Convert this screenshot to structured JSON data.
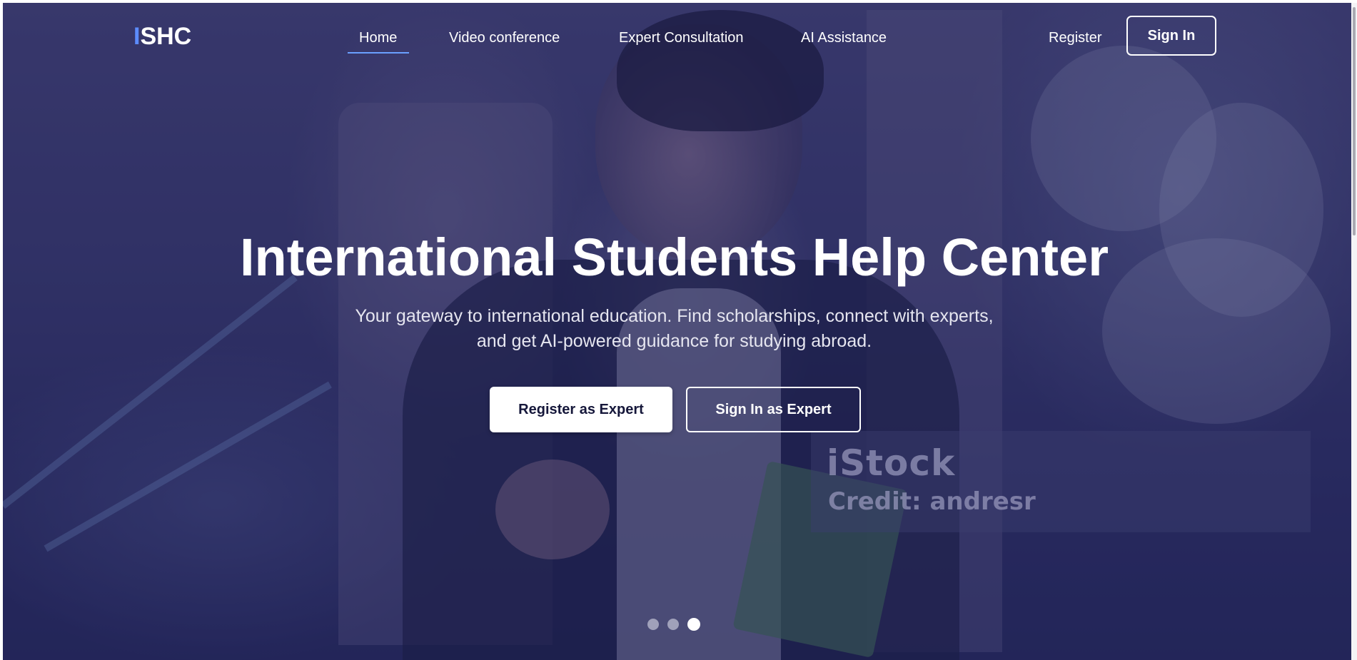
{
  "brand": {
    "logo_accent": "I",
    "logo_rest": "SHC",
    "accent_color": "#5c8cff"
  },
  "nav": {
    "items": [
      {
        "label": "Home",
        "active": true
      },
      {
        "label": "Video conference",
        "active": false
      },
      {
        "label": "Expert Consultation",
        "active": false
      },
      {
        "label": "AI Assistance",
        "active": false
      }
    ],
    "register_label": "Register",
    "signin_label": "Sign In"
  },
  "hero": {
    "title": "International Students Help Center",
    "subtitle_line1": "Your gateway to international education. Find scholarships, connect with experts,",
    "subtitle_line2": "and get AI-powered guidance for studying abroad.",
    "primary_button": "Register as Expert",
    "secondary_button": "Sign In as Expert"
  },
  "watermark": {
    "logo": "iStock",
    "credit": "Credit: andresr"
  },
  "carousel": {
    "slide_count": 3,
    "active_index": 2
  },
  "colors": {
    "overlay": "#1e205a",
    "underline": "#6aa0ff",
    "primary_button_text": "#15173a"
  }
}
